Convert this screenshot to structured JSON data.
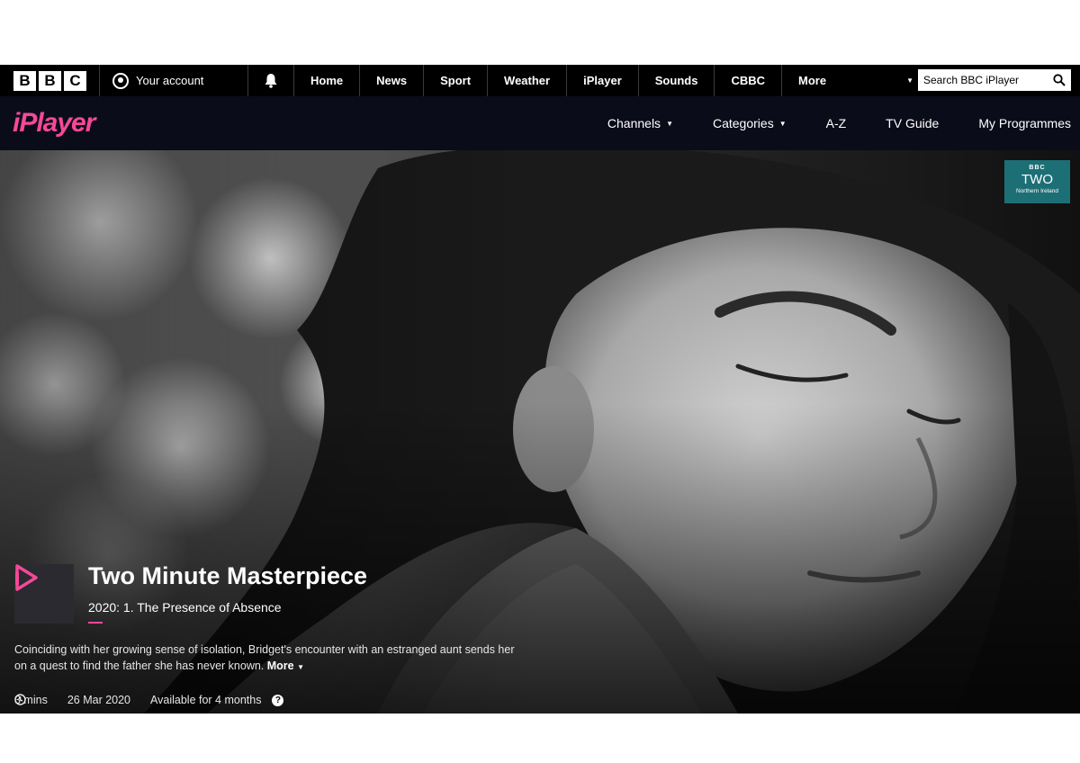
{
  "bbc_bar": {
    "logo_letters": [
      "B",
      "B",
      "C"
    ],
    "account_label": "Your account",
    "nav": [
      "Home",
      "News",
      "Sport",
      "Weather",
      "iPlayer",
      "Sounds",
      "CBBC"
    ],
    "more_label": "More",
    "search_placeholder": "Search BBC iPlayer"
  },
  "iplayer_bar": {
    "logo": "iPlayer",
    "nav": {
      "channels": "Channels",
      "categories": "Categories",
      "az": "A-Z",
      "tv_guide": "TV Guide",
      "my_programmes": "My Programmes"
    }
  },
  "channel_badge": {
    "bbc": "BBC",
    "name": "TWO",
    "region": "Northern Ireland",
    "color": "#1d6f76"
  },
  "programme": {
    "title": "Two Minute Masterpiece",
    "episode": "2020: 1. The Presence of Absence",
    "synopsis": "Coinciding with her growing sense of isolation, Bridget's encounter with an estranged aunt sends her on a quest to find the father she has never known.",
    "more_label": "More",
    "duration": "3 mins",
    "date": "26 Mar 2020",
    "availability": "Available for 4 months"
  },
  "colors": {
    "accent_pink": "#f54997",
    "iplayer_bar_bg": "#0b0c1a",
    "bbc_bar_bg": "#000000"
  },
  "icons": [
    "account-icon",
    "bell-icon",
    "dropdown-caret-icon",
    "search-icon",
    "play-icon",
    "clock-icon",
    "help-icon"
  ]
}
